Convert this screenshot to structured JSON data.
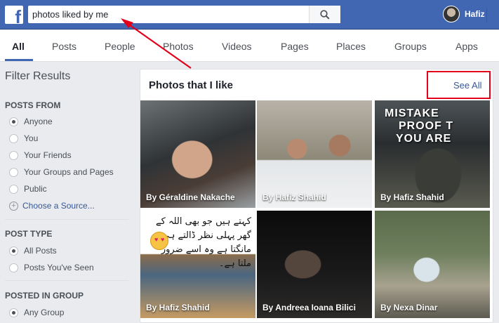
{
  "header": {
    "logo_letter": "f",
    "search": {
      "value": "photos liked by me"
    },
    "profile_name": "Hafiz"
  },
  "tabs": [
    {
      "label": "All",
      "active": true
    },
    {
      "label": "Posts"
    },
    {
      "label": "People"
    },
    {
      "label": "Photos"
    },
    {
      "label": "Videos"
    },
    {
      "label": "Pages"
    },
    {
      "label": "Places"
    },
    {
      "label": "Groups"
    },
    {
      "label": "Apps"
    }
  ],
  "sidebar": {
    "title": "Filter Results",
    "posts_from": {
      "heading": "POSTS FROM",
      "options": [
        "Anyone",
        "You",
        "Your Friends",
        "Your Groups and Pages",
        "Public"
      ],
      "selected": "Anyone",
      "choose_source": "Choose a Source..."
    },
    "post_type": {
      "heading": "POST TYPE",
      "options": [
        "All Posts",
        "Posts You've Seen"
      ],
      "selected": "All Posts"
    },
    "posted_in_group": {
      "heading": "POSTED IN GROUP",
      "options": [
        "Any Group"
      ],
      "selected": "Any Group"
    }
  },
  "results": {
    "title": "Photos that I like",
    "see_all": "See All",
    "photos": [
      {
        "caption": "By Géraldine Nakache"
      },
      {
        "caption": "By Hafiz Shahid"
      },
      {
        "caption": "By Hafiz Shahid",
        "overlay_text": [
          "MISTAKE",
          "PROOF T",
          "YOU ARE"
        ]
      },
      {
        "caption": "By Hafiz Shahid",
        "overlay_text": [
          "کہتے ہیں جو بھی اللہ کے گھر پہلی نظر ڈالتے ہی",
          "مانگتا ہے وہ اسے ضرور ملتا ہے۔"
        ]
      },
      {
        "caption": "By Andreea Ioana Bilici"
      },
      {
        "caption": "By Nexa Dinar"
      }
    ]
  },
  "colors": {
    "facebook_blue": "#4267b2",
    "annotation_red": "#e2001a"
  }
}
